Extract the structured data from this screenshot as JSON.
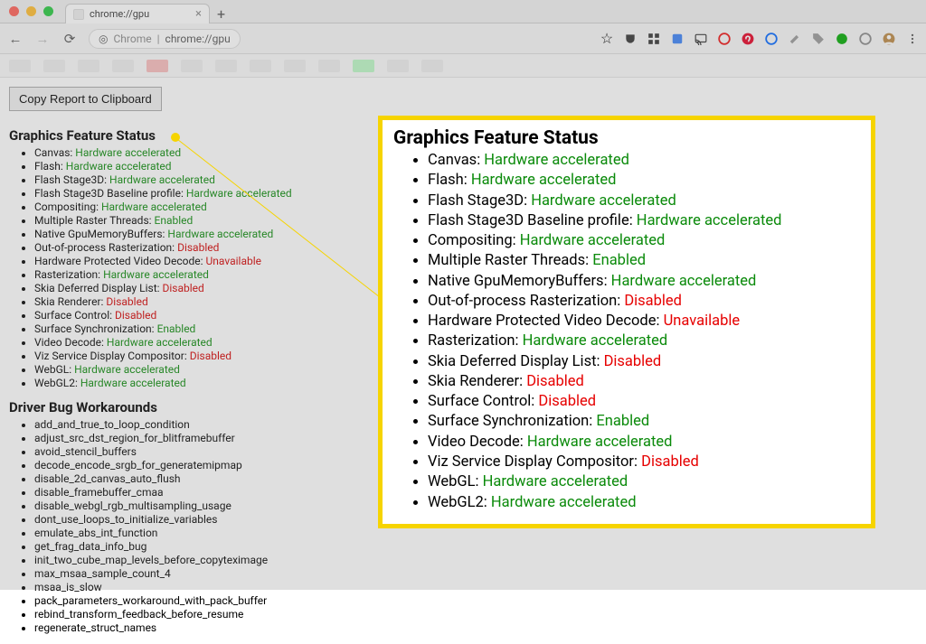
{
  "tab": {
    "title": "chrome://gpu",
    "close": "×",
    "new": "+"
  },
  "address": {
    "scheme_icon": "⊙",
    "scheme": "Chrome",
    "sep": "|",
    "url": "chrome://gpu"
  },
  "nav": {
    "back": "←",
    "forward": "→",
    "reload": "⟳",
    "star": "☆"
  },
  "copy_button": "Copy Report to Clipboard",
  "gfs_title": "Graphics Feature Status",
  "features": [
    {
      "name": "Canvas",
      "status": "Hardware accelerated",
      "cls": "green"
    },
    {
      "name": "Flash",
      "status": "Hardware accelerated",
      "cls": "green"
    },
    {
      "name": "Flash Stage3D",
      "status": "Hardware accelerated",
      "cls": "green"
    },
    {
      "name": "Flash Stage3D Baseline profile",
      "status": "Hardware accelerated",
      "cls": "green"
    },
    {
      "name": "Compositing",
      "status": "Hardware accelerated",
      "cls": "green"
    },
    {
      "name": "Multiple Raster Threads",
      "status": "Enabled",
      "cls": "green"
    },
    {
      "name": "Native GpuMemoryBuffers",
      "status": "Hardware accelerated",
      "cls": "green"
    },
    {
      "name": "Out-of-process Rasterization",
      "status": "Disabled",
      "cls": "red"
    },
    {
      "name": "Hardware Protected Video Decode",
      "status": "Unavailable",
      "cls": "red"
    },
    {
      "name": "Rasterization",
      "status": "Hardware accelerated",
      "cls": "green"
    },
    {
      "name": "Skia Deferred Display List",
      "status": "Disabled",
      "cls": "red"
    },
    {
      "name": "Skia Renderer",
      "status": "Disabled",
      "cls": "red"
    },
    {
      "name": "Surface Control",
      "status": "Disabled",
      "cls": "red"
    },
    {
      "name": "Surface Synchronization",
      "status": "Enabled",
      "cls": "green"
    },
    {
      "name": "Video Decode",
      "status": "Hardware accelerated",
      "cls": "green"
    },
    {
      "name": "Viz Service Display Compositor",
      "status": "Disabled",
      "cls": "red"
    },
    {
      "name": "WebGL",
      "status": "Hardware accelerated",
      "cls": "green"
    },
    {
      "name": "WebGL2",
      "status": "Hardware accelerated",
      "cls": "green"
    }
  ],
  "dbw_title": "Driver Bug Workarounds",
  "workarounds": [
    "add_and_true_to_loop_condition",
    "adjust_src_dst_region_for_blitframebuffer",
    "avoid_stencil_buffers",
    "decode_encode_srgb_for_generatemipmap",
    "disable_2d_canvas_auto_flush",
    "disable_framebuffer_cmaa",
    "disable_webgl_rgb_multisampling_usage",
    "dont_use_loops_to_initialize_variables",
    "emulate_abs_int_function",
    "get_frag_data_info_bug",
    "init_two_cube_map_levels_before_copyteximage",
    "max_msaa_sample_count_4",
    "msaa_is_slow",
    "pack_parameters_workaround_with_pack_buffer",
    "rebind_transform_feedback_before_resume",
    "regenerate_struct_names"
  ],
  "toolbar_icons": {
    "star": "star-icon",
    "pocket": "pocket-icon",
    "grid": "grid-icon",
    "badge": "badge-icon",
    "cast": "cast-icon",
    "red_circle": "circle-red-icon",
    "pinterest": "pinterest-icon",
    "blue_circle": "circle-blue-icon",
    "edit": "edit-icon",
    "tag": "tag-icon",
    "green_circle": "circle-green-icon",
    "grey_circle": "circle-grey-icon",
    "avatar": "avatar-icon",
    "menu": "menu-icon"
  }
}
